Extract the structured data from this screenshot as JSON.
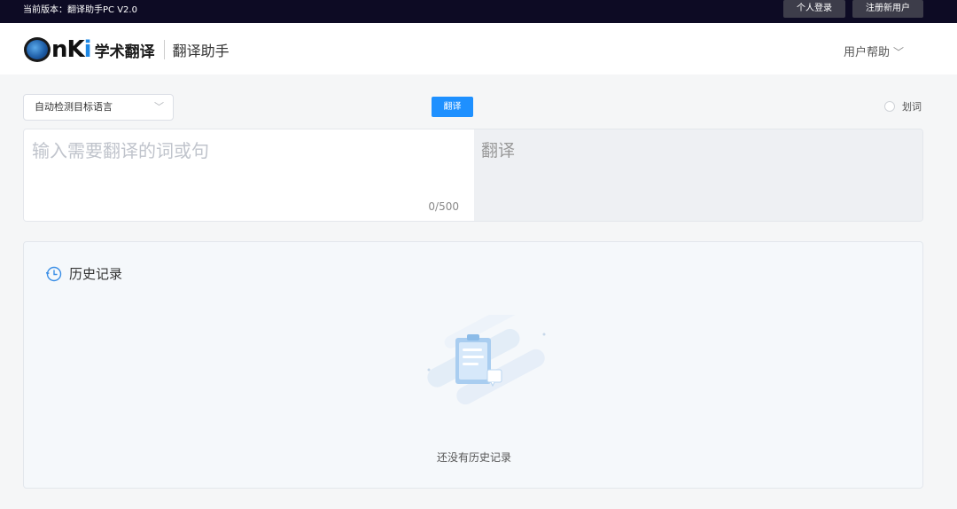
{
  "topbar": {
    "version": "当前版本：翻译助手PC V2.0",
    "login_label": "个人登录",
    "register_label": "注册新用户"
  },
  "header": {
    "logo_cnki": "CNKI",
    "logo_name": "学术翻译",
    "subtitle": "翻译助手",
    "help_label": "用户帮助",
    "help_icon": "chevron-down-icon"
  },
  "toolbar": {
    "lang_selected": "自动检测目标语言",
    "translate_label": "翻译",
    "word_label": "划词"
  },
  "editor": {
    "input_placeholder": "输入需要翻译的词或句",
    "counter": "0/500",
    "output_placeholder": "翻译"
  },
  "history": {
    "title": "历史记录",
    "icon": "clock-icon",
    "empty_text": "还没有历史记录"
  },
  "colors": {
    "topbar_bg": "#0d0b24",
    "accent": "#1e90ff",
    "page_bg": "#f5f6f7"
  }
}
